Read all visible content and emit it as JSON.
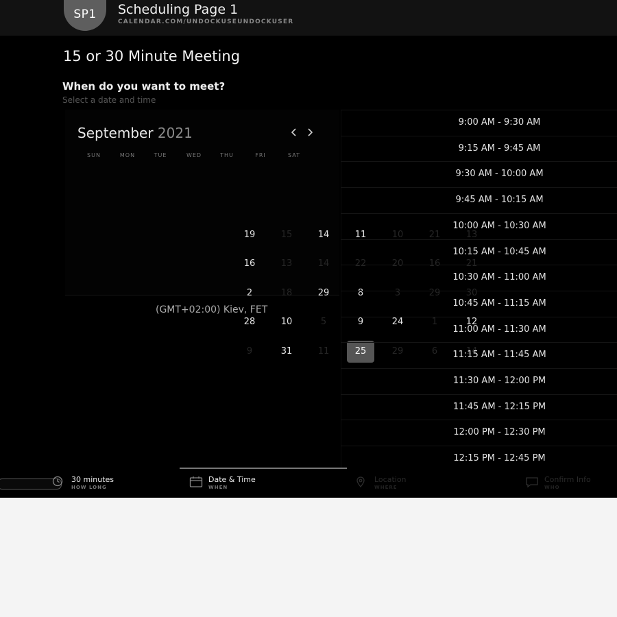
{
  "header": {
    "avatar_initials": "SP1",
    "title": "Scheduling Page 1",
    "url": "CALENDAR.COM/UNDOCKUSEUNDOCKUSER"
  },
  "meeting": {
    "title": "15 or 30 Minute Meeting",
    "question": "When do you want to meet?",
    "subtitle": "Select a date and time"
  },
  "calendar": {
    "month": "September",
    "year": "2021",
    "prev_icon": "chevron-left-icon",
    "next_icon": "chevron-right-icon",
    "weekdays": [
      "SUN",
      "MON",
      "TUE",
      "WED",
      "THU",
      "FRI",
      "SAT"
    ],
    "days": [
      {
        "label": "19",
        "state": "on"
      },
      {
        "label": "15",
        "state": "off"
      },
      {
        "label": "14",
        "state": "on"
      },
      {
        "label": "11",
        "state": "on"
      },
      {
        "label": "10",
        "state": "off"
      },
      {
        "label": "21",
        "state": "off"
      },
      {
        "label": "13",
        "state": "off"
      },
      {
        "label": "16",
        "state": "on"
      },
      {
        "label": "13",
        "state": "off"
      },
      {
        "label": "14",
        "state": "off"
      },
      {
        "label": "22",
        "state": "off"
      },
      {
        "label": "20",
        "state": "off"
      },
      {
        "label": "16",
        "state": "off"
      },
      {
        "label": "21",
        "state": "off"
      },
      {
        "label": "2",
        "state": "on"
      },
      {
        "label": "18",
        "state": "off"
      },
      {
        "label": "29",
        "state": "on"
      },
      {
        "label": "8",
        "state": "on"
      },
      {
        "label": "3",
        "state": "off"
      },
      {
        "label": "29",
        "state": "off"
      },
      {
        "label": "30",
        "state": "off"
      },
      {
        "label": "28",
        "state": "on"
      },
      {
        "label": "10",
        "state": "on"
      },
      {
        "label": "5",
        "state": "off"
      },
      {
        "label": "9",
        "state": "on"
      },
      {
        "label": "24",
        "state": "on"
      },
      {
        "label": "1",
        "state": "off"
      },
      {
        "label": "12",
        "state": "on"
      },
      {
        "label": "9",
        "state": "off"
      },
      {
        "label": "31",
        "state": "on"
      },
      {
        "label": "11",
        "state": "off"
      },
      {
        "label": "25",
        "state": "selected"
      },
      {
        "label": "29",
        "state": "off"
      },
      {
        "label": "6",
        "state": "off"
      },
      {
        "label": "14",
        "state": "off"
      }
    ],
    "timezone": "(GMT+02:00) Kiev, FET"
  },
  "time_slots": [
    "9:00 AM - 9:30 AM",
    "9:15 AM - 9:45 AM",
    "9:30 AM - 10:00 AM",
    "9:45 AM - 10:15 AM",
    "10:00 AM - 10:30 AM",
    "10:15 AM - 10:45 AM",
    "10:30 AM - 11:00 AM",
    "10:45 AM - 11:15 AM",
    "11:00 AM - 11:30 AM",
    "11:15 AM - 11:45 AM",
    "11:30 AM - 12:00 PM",
    "11:45 AM - 12:15 PM",
    "12:00 PM - 12:30 PM",
    "12:15 PM - 12:45 PM"
  ],
  "steps": [
    {
      "label": "30 minutes",
      "sub": "HOW LONG",
      "icon": "clock-icon",
      "label_color": "#eeeeee",
      "sub_color": "#777777"
    },
    {
      "label": "Date & Time",
      "sub": "WHEN",
      "icon": "calendar-icon",
      "label_color": "#eeeeee",
      "sub_color": "#777777"
    },
    {
      "label": "Location",
      "sub": "WHERE",
      "icon": "location-pin-icon",
      "label_color": "#2a2a2a",
      "sub_color": "#222222"
    },
    {
      "label": "Confirm Info",
      "sub": "WHO",
      "icon": "chat-icon",
      "label_color": "#2a2a2a",
      "sub_color": "#222222"
    }
  ]
}
